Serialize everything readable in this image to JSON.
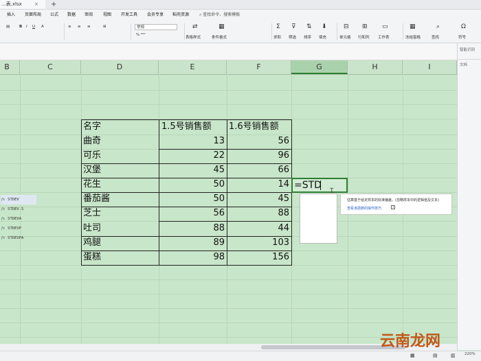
{
  "window": {
    "file_tab": "...表.xlsx",
    "tab_close": "×",
    "tab_add": "+"
  },
  "menu": {
    "items": [
      "插入",
      "页面布局",
      "公式",
      "数据",
      "审阅",
      "视图",
      "开发工具",
      "会员专享",
      "稻壳资源"
    ],
    "search": "查找命令、搜索模板"
  },
  "ribbon": {
    "font_name": "常规",
    "labels": [
      "表格样式",
      "条件格式",
      "求和",
      "筛选",
      "排序",
      "填充",
      "单元格",
      "行和列",
      "工作表",
      "冻结窗格",
      "查找",
      "符号"
    ]
  },
  "columns": [
    "B",
    "C",
    "D",
    "E",
    "F",
    "G",
    "H",
    "I"
  ],
  "active_column": "G",
  "table": {
    "header": [
      "名字",
      "1.5号销售额",
      "1.6号销售额"
    ],
    "rows": [
      {
        "name": "曲奇",
        "d1": "13",
        "d2": "56"
      },
      {
        "name": "可乐",
        "d1": "22",
        "d2": "96"
      },
      {
        "name": "汉堡",
        "d1": "45",
        "d2": "66"
      },
      {
        "name": "花生",
        "d1": "50",
        "d2": "14"
      },
      {
        "name": "番茄酱",
        "d1": "50",
        "d2": "45"
      },
      {
        "name": "芝士",
        "d1": "56",
        "d2": "88"
      },
      {
        "name": "吐司",
        "d1": "88",
        "d2": "44"
      },
      {
        "name": "鸡腿",
        "d1": "89",
        "d2": "103"
      },
      {
        "name": "蛋糕",
        "d1": "98",
        "d2": "156"
      }
    ]
  },
  "formula": {
    "input": "=STD"
  },
  "autocomplete": {
    "items": [
      "STDEV",
      "STDEV.S",
      "STDEVA",
      "STDEVP",
      "STDEVPA"
    ],
    "fx": "fx",
    "description": "估算基于给定样本的标准偏差。(忽略样本中的逻辑值及文本)",
    "link": "查看该函数的操作技巧",
    "help": "?"
  },
  "right_pane": {
    "title": "智能识别",
    "item": "文档"
  },
  "status": {
    "zoom": "220%"
  },
  "watermark": "云南龙网",
  "colors": {
    "sheet_bg": "#c8e6c9",
    "active_border": "#2e7d32",
    "link": "#2a64c5"
  }
}
